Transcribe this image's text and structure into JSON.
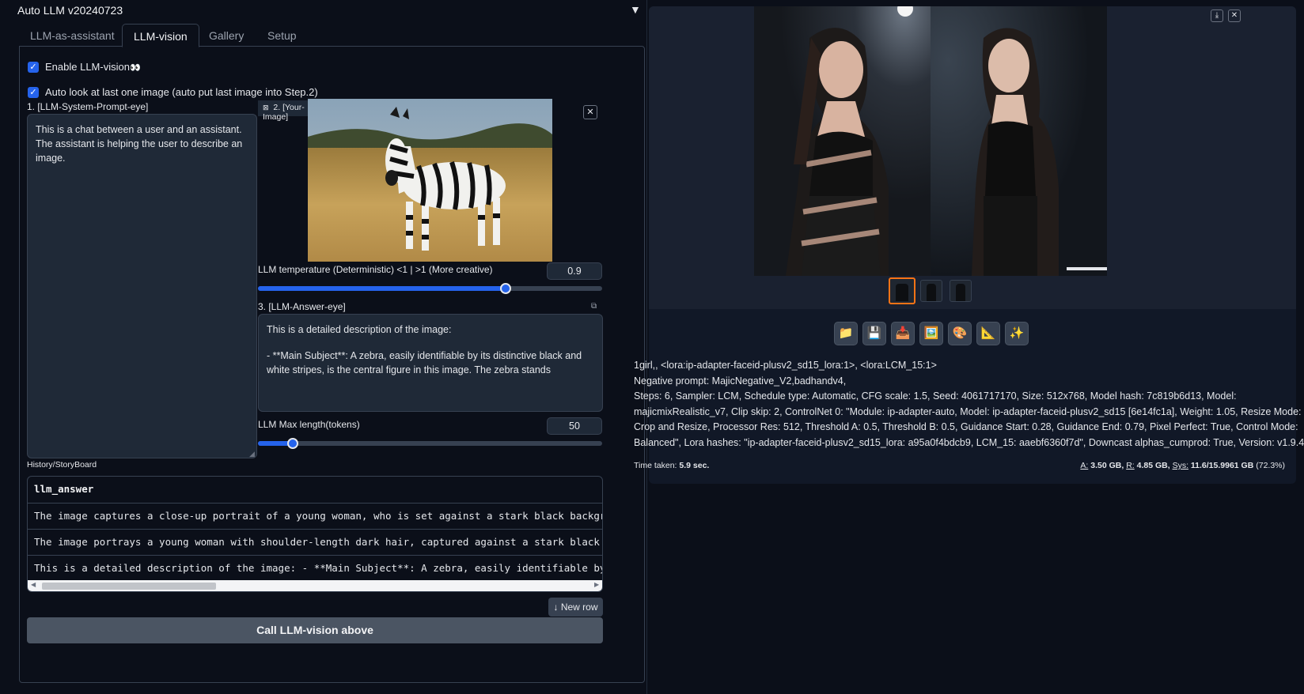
{
  "accordion": {
    "title": "Auto LLM v20240723",
    "toggle": "▼"
  },
  "tabs": [
    {
      "label": "LLM-as-assistant"
    },
    {
      "label": "LLM-vision"
    },
    {
      "label": "Gallery"
    },
    {
      "label": "Setup"
    }
  ],
  "vision": {
    "enable_label": "Enable LLM-vision",
    "enable_icon": "👀",
    "auto_look_label": "Auto look at last one image (auto put last image into Step.2)",
    "system_prompt_label": "1. [LLM-System-Prompt-eye]",
    "system_prompt_value": "This is a chat between a user and an assistant. The assistant is helping the user to describe an image.",
    "image_label": "2. [Your-Image]",
    "temperature_label": "LLM temperature (Deterministic) <1 | >1 (More creative)",
    "temperature_value": "0.9",
    "temperature_fraction": 0.72,
    "answer_label": "3. [LLM-Answer-eye]",
    "answer_line1": "This is a detailed description of the image:",
    "answer_line2": "- **Main Subject**: A zebra, easily identifiable by its distinctive black and white stripes, is the central figure in this image. The zebra stands",
    "max_length_label": "LLM Max length(tokens)",
    "max_length_value": "50",
    "max_length_fraction": 0.1
  },
  "history": {
    "label": "History/StoryBoard",
    "header": "llm_answer",
    "rows": [
      "The image captures a close-up portrait of a young woman, who is set against a stark black background. Her hair",
      "The image portrays a young woman with shoulder-length dark hair, captured against a stark black background. Her",
      "This is a detailed description of the image: - **Main Subject**: A zebra, easily identifiable by its distinctive"
    ],
    "new_row_label": "New row",
    "call_button_label": "Call LLM-vision above"
  },
  "gallery": {
    "toolbar_icons": [
      "📁",
      "💾",
      "📥",
      "🖼️",
      "🎨",
      "📐",
      "✨"
    ],
    "info_line1": "1girl,, <lora:ip-adapter-faceid-plusv2_sd15_lora:1>, <lora:LCM_15:1>",
    "info_line2": "Negative prompt: MajicNegative_V2,badhandv4,",
    "info_line3": "Steps: 6, Sampler: LCM, Schedule type: Automatic, CFG scale: 1.5, Seed: 4061717170, Size: 512x768, Model hash: 7c819b6d13, Model:",
    "info_line4": "majicmixRealistic_v7, Clip skip: 2, ControlNet 0: \"Module: ip-adapter-auto, Model: ip-adapter-faceid-plusv2_sd15 [6e14fc1a], Weight: 1.05, Resize Mode:",
    "info_line5": "Crop and Resize, Processor Res: 512, Threshold A: 0.5, Threshold B: 0.5, Guidance Start: 0.28, Guidance End: 0.79, Pixel Perfect: True, Control Mode:",
    "info_line6": "Balanced\", Lora hashes: \"ip-adapter-faceid-plusv2_sd15_lora: a95a0f4bdcb9, LCM_15: aaebf6360f7d\", Downcast alphas_cumprod: True, Version: v1.9.4",
    "time_label": "Time taken:",
    "time_value": "5.9 sec.",
    "mem_a_label": "A:",
    "mem_a_value": "3.50 GB,",
    "mem_r_label": "R:",
    "mem_r_value": "4.85 GB,",
    "mem_sys_label": "Sys:",
    "mem_sys_value": "11.6/15.9961 GB",
    "mem_pct": "(72.3%)"
  },
  "colors": {
    "accent": "#2563eb",
    "bg": "#0b0f19",
    "panel": "#111827",
    "highlight": "#f97316"
  }
}
